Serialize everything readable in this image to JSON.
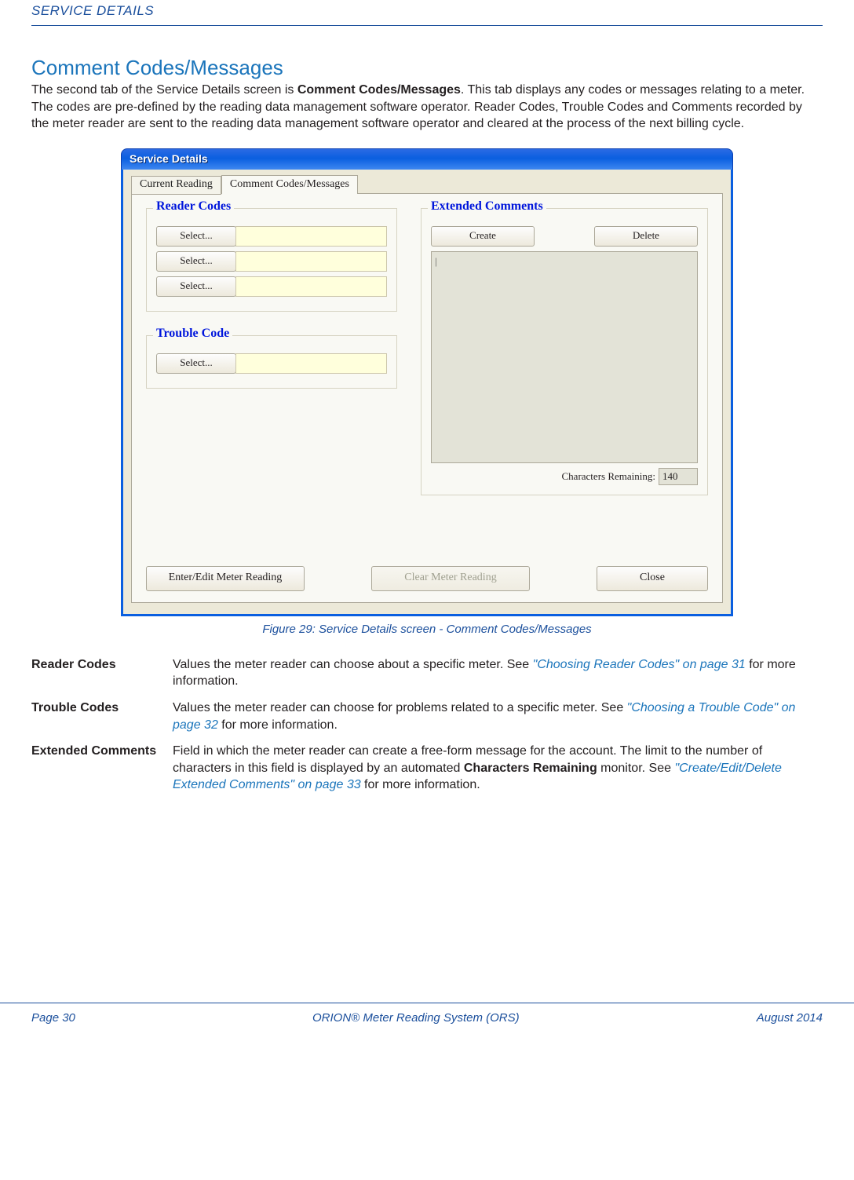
{
  "header": {
    "section_label": "SERVICE DETAILS"
  },
  "section": {
    "title": "Comment Codes/Messages",
    "intro_1": "The second tab of the Service Details screen is ",
    "intro_bold": "Comment Codes/Messages",
    "intro_2": ". This tab displays any codes or messages relating to a meter. The codes are pre-defined by the reading data management software operator. Reader Codes, Trouble Codes and Comments recorded by the meter reader are sent to the reading data management software operator and cleared at the process of the next billing cycle."
  },
  "window": {
    "title": "Service Details",
    "tabs": {
      "current_reading": "Current Reading",
      "comment_codes": "Comment Codes/Messages"
    },
    "reader_codes": {
      "legend": "Reader Codes",
      "select": "Select..."
    },
    "trouble_code": {
      "legend": "Trouble Code",
      "select": "Select..."
    },
    "extended": {
      "legend": "Extended Comments",
      "create": "Create",
      "delete": "Delete",
      "textarea_value": "|",
      "chars_label": "Characters Remaining:",
      "chars_value": "140"
    },
    "bottom": {
      "enter_edit": "Enter/Edit Meter Reading",
      "clear": "Clear Meter Reading",
      "close": "Close"
    }
  },
  "figure_caption": "Figure 29:  Service Details screen - Comment Codes/Messages",
  "defs": {
    "reader_codes": {
      "term": "Reader Codes",
      "text_1": "Values the meter reader can choose about a specific meter. See ",
      "link": "\"Choosing Reader Codes\" on page 31",
      "text_2": " for more information."
    },
    "trouble_codes": {
      "term": "Trouble Codes",
      "text_1": "Values the meter reader can choose for problems related to a specific meter. See ",
      "link": "\"Choosing a Trouble Code\" on page 32",
      "text_2": " for more information."
    },
    "extended": {
      "term": "Extended Comments",
      "text_1": "Field in which the meter reader can create a free-form message for the account. The limit to the number of characters in this field is displayed by an automated ",
      "bold": "Characters Remaining",
      "text_2": " monitor. See ",
      "link": "\"Create/Edit/Delete Extended Comments\" on page 33",
      "text_3": " for more information."
    }
  },
  "footer": {
    "page": "Page 30",
    "product": "ORION® Meter Reading System (ORS)",
    "date": "August  2014"
  }
}
